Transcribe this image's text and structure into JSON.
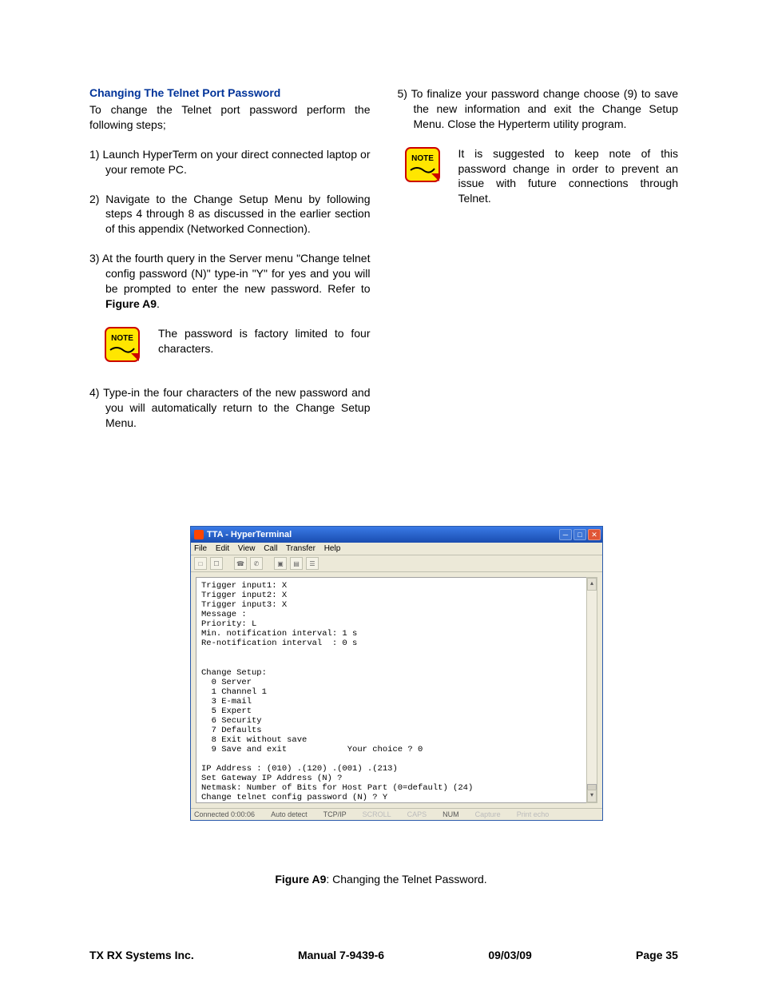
{
  "heading": "Changing The Telnet Port Password",
  "intro": "To change the Telnet port password perform the following steps;",
  "steps": {
    "s1": "1)  Launch HyperTerm on your direct connected laptop or your remote PC.",
    "s2": "2)  Navigate to the Change Setup Menu by following steps 4 through 8 as discussed in the earlier section of this appendix (Networked Connection).",
    "s3a": "3)  At the fourth query in the Server menu \"Change telnet config password (N)\" type-in \"Y\" for yes and you will be prompted to enter the new password. Refer to ",
    "s3b": "Figure A9",
    "s3c": ".",
    "s4": "4)  Type-in the four characters of the new password and you will automatically return to the Change Setup Menu.",
    "s5": "5)  To finalize your password change choose (9) to save the new information and exit the Change Setup Menu. Close the Hyperterm utility program."
  },
  "note1": "The password is factory limited to four characters.",
  "note2": "It is suggested to keep note of this password change in order to prevent an issue with future connections through Telnet.",
  "noteLabel": "NOTE",
  "windowTitle": "TTA - HyperTerminal",
  "menus": {
    "file": "File",
    "edit": "Edit",
    "view": "View",
    "call": "Call",
    "transfer": "Transfer",
    "help": "Help"
  },
  "terminal": "Trigger input1: X\nTrigger input2: X\nTrigger input3: X\nMessage :\nPriority: L\nMin. notification interval: 1 s\nRe-notification interval  : 0 s\n\n\nChange Setup:\n  0 Server\n  1 Channel 1\n  3 E-mail\n  5 Expert\n  6 Security\n  7 Defaults\n  8 Exit without save\n  9 Save and exit            Your choice ? 0\n\nIP Address : (010) .(120) .(001) .(213)\nSet Gateway IP Address (N) ?\nNetmask: Number of Bits for Host Part (0=default) (24)\nChange telnet config password (N) ? Y\nEnter new Password: _",
  "status": {
    "connected": "Connected 0:00:06",
    "auto": "Auto detect",
    "proto": "TCP/IP",
    "scroll": "SCROLL",
    "caps": "CAPS",
    "num": "NUM",
    "capture": "Capture",
    "printecho": "Print echo"
  },
  "captionBold": "Figure A9",
  "captionRest": ": Changing the Telnet Password.",
  "footer": {
    "company": "TX RX Systems Inc.",
    "manual": "Manual 7-9439-6",
    "date": "09/03/09",
    "page": "Page 35"
  }
}
